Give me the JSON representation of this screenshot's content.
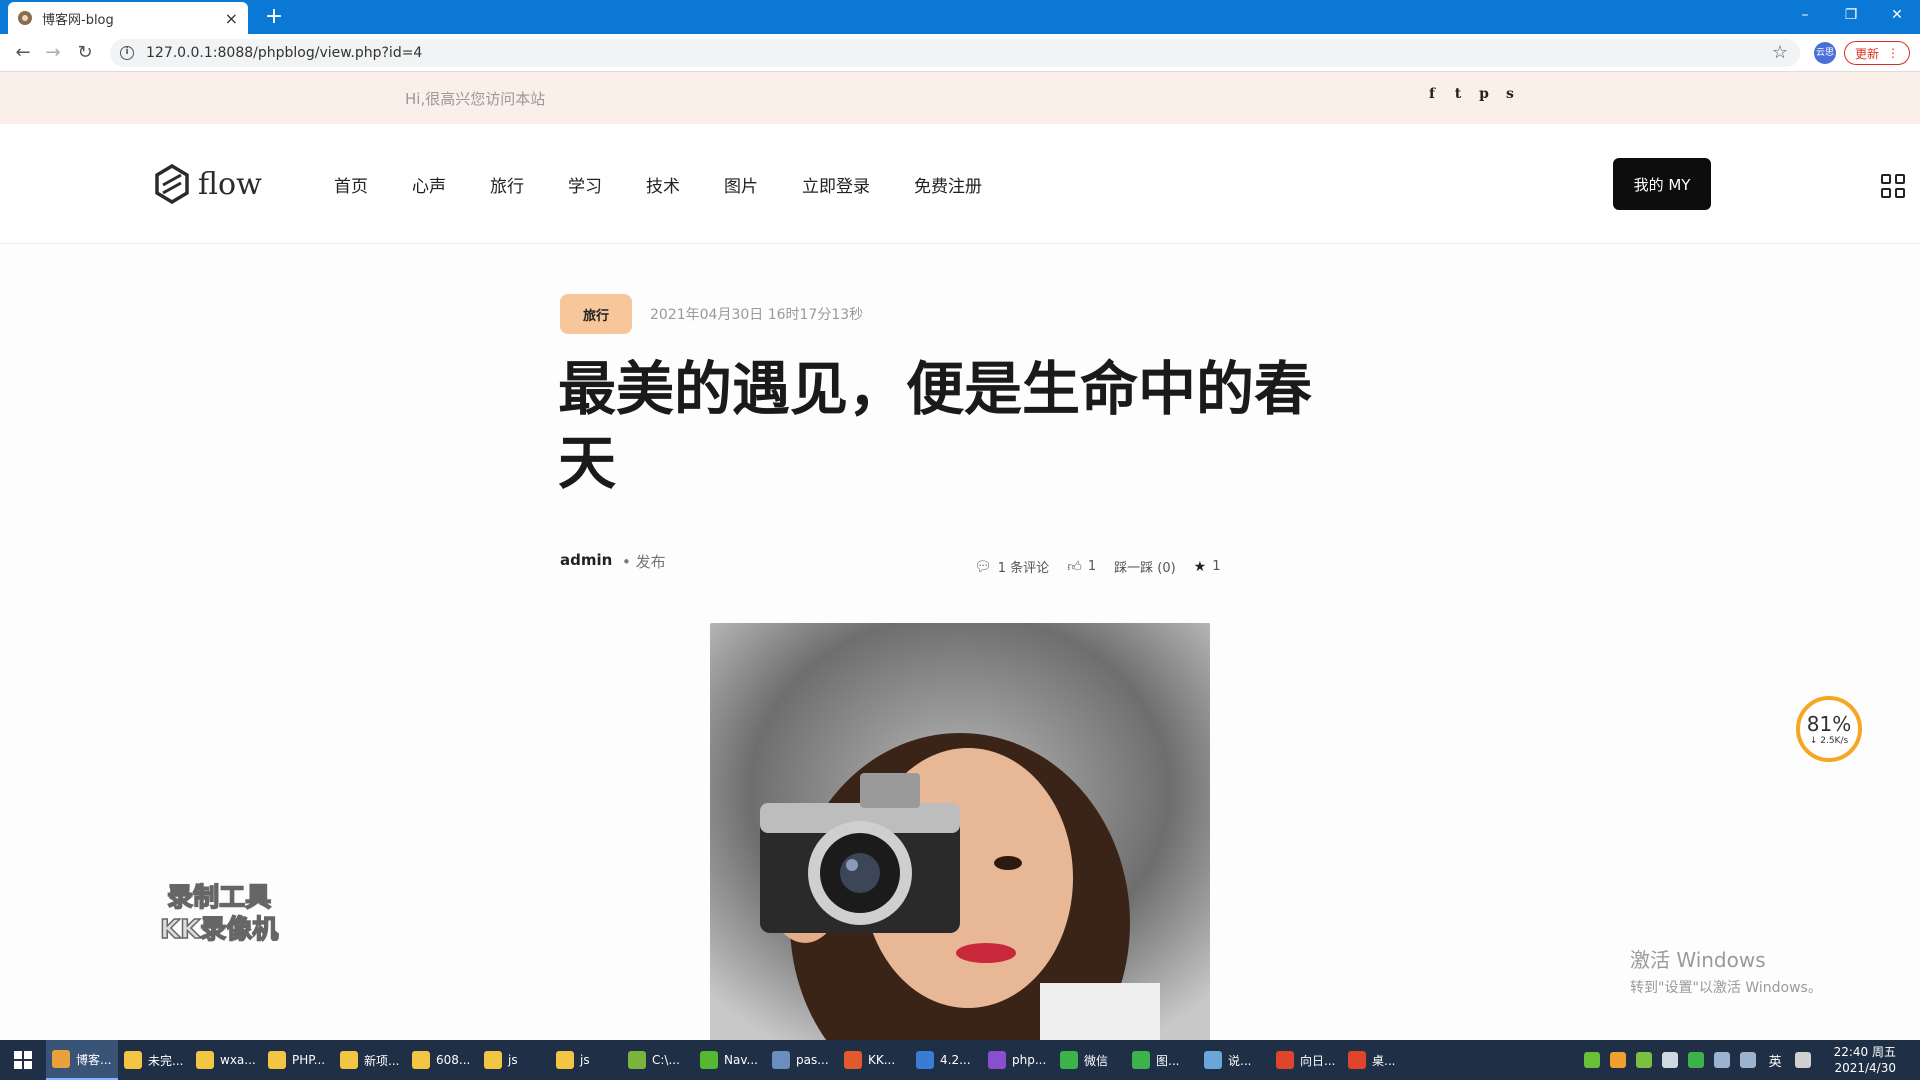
{
  "browser": {
    "tab_title": "博客网-blog",
    "tab_close": "×",
    "new_tab": "+",
    "url": "127.0.0.1:8088/phpblog/view.php?id=4",
    "profile_label": "云思",
    "update_label": "更新",
    "window_controls": [
      "–",
      "❐",
      "✕"
    ]
  },
  "topbar": {
    "greeting": "Hi,很高兴您访问本站",
    "social": [
      "f",
      "t",
      "p",
      "s"
    ]
  },
  "header": {
    "logo_text": "flow",
    "nav": [
      "首页",
      "心声",
      "旅行",
      "学习",
      "技术",
      "图片",
      "立即登录",
      "免费注册"
    ],
    "my_button": "我的 MY"
  },
  "post": {
    "category": "旅行",
    "date": "2021年04月30日 16时17分13秒",
    "title": "最美的遇见，便是生命中的春天",
    "author": "admin",
    "published": "• 发布",
    "comments": "1 条评论",
    "likes": "1",
    "dislike": "踩一踩 (0)",
    "favorites": "1"
  },
  "overlays": {
    "recorder_line1": "录制工具",
    "recorder_line2": "KK录像机",
    "activate_title": "激活 Windows",
    "activate_sub": "转到\"设置\"以激活 Windows。",
    "speed_percent": "81%",
    "speed_rate": "↓ 2.5K/s"
  },
  "taskbar": {
    "items": [
      {
        "label": "博客...",
        "color": "#e9a13b",
        "active": true
      },
      {
        "label": "未完...",
        "color": "#f3c544"
      },
      {
        "label": "wxa...",
        "color": "#f3c544"
      },
      {
        "label": "PHP...",
        "color": "#f3c544"
      },
      {
        "label": "新项...",
        "color": "#f3c544"
      },
      {
        "label": "608...",
        "color": "#f3c544"
      },
      {
        "label": "js",
        "color": "#f3c544"
      },
      {
        "label": "js",
        "color": "#f3c544"
      },
      {
        "label": "C:\\...",
        "color": "#7ab53b"
      },
      {
        "label": "Nav...",
        "color": "#55b833"
      },
      {
        "label": "pas...",
        "color": "#6c8ebf"
      },
      {
        "label": "KK...",
        "color": "#e05a2b"
      },
      {
        "label": "4.2...",
        "color": "#3a7bd5"
      },
      {
        "label": "php...",
        "color": "#8a4fd0"
      },
      {
        "label": "微信",
        "color": "#3cb34a"
      },
      {
        "label": "图...",
        "color": "#3cb34a"
      },
      {
        "label": "说...",
        "color": "#6aa6d9"
      },
      {
        "label": "向日...",
        "color": "#e0452b"
      },
      {
        "label": "桌...",
        "color": "#e0452b"
      }
    ],
    "lang": "英",
    "time": "22:40 周五",
    "date": "2021/4/30"
  }
}
